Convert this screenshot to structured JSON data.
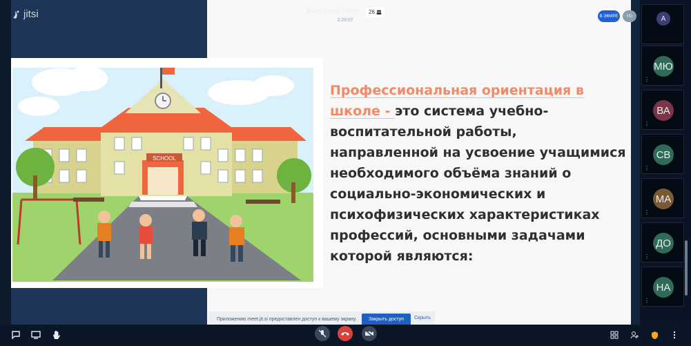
{
  "app": {
    "logo_text": "jitsi"
  },
  "header": {
    "title": "Perviy Online Forum",
    "timer": "3:28:07",
    "participant_count": "26",
    "live_label": "В ЭФИРЕ",
    "hd_label": "HD"
  },
  "slide": {
    "highlight": "Профессиональная ориентация в школе - ",
    "body": "это система учебно-воспитательной работы, направленной на усвоение учащимися необходимого объёма знаний о социально-экономических и психофизических характеристиках профессий, основными задачами которой являются:",
    "sign_text": "SCHOOL"
  },
  "filmstrip": {
    "participants": [
      {
        "initials": "A",
        "color": "#3a3f75"
      },
      {
        "initials": "МЮ",
        "color": "#2f6b57"
      },
      {
        "initials": "ВА",
        "color": "#7a3546"
      },
      {
        "initials": "СВ",
        "color": "#2f6b57"
      },
      {
        "initials": "МА",
        "color": "#7a5a34"
      },
      {
        "initials": "ДО",
        "color": "#2f6b57"
      },
      {
        "initials": "НА",
        "color": "#2f6b57"
      }
    ]
  },
  "notification": {
    "text": "Приложению meet.jit.si предоставлен доступ к вашему экрану.",
    "share_button": "Закрыть доступ",
    "hide_link": "Скрыть"
  },
  "colors": {
    "accent": "#1f5fbf",
    "hangup": "#d9413a",
    "highlight_text": "#f28a67"
  }
}
